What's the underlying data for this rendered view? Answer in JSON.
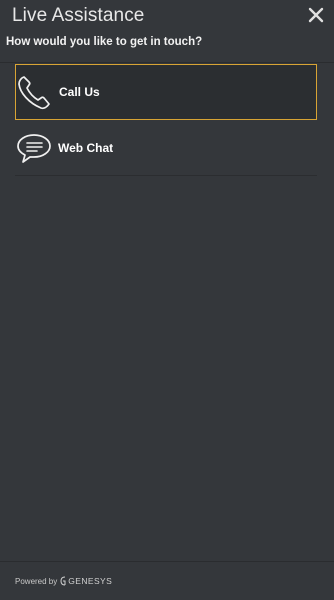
{
  "header": {
    "title": "Live Assistance",
    "subtitle": "How would you like to get in touch?",
    "close_icon": "close-icon"
  },
  "options": [
    {
      "label": "Call Us",
      "icon": "phone-icon",
      "selected": true
    },
    {
      "label": "Web Chat",
      "icon": "chat-bubble-icon",
      "selected": false
    }
  ],
  "footer": {
    "powered_by": "Powered by",
    "brand": "GENESYS"
  },
  "colors": {
    "background": "#34373b",
    "selected_border": "#d8a434"
  }
}
